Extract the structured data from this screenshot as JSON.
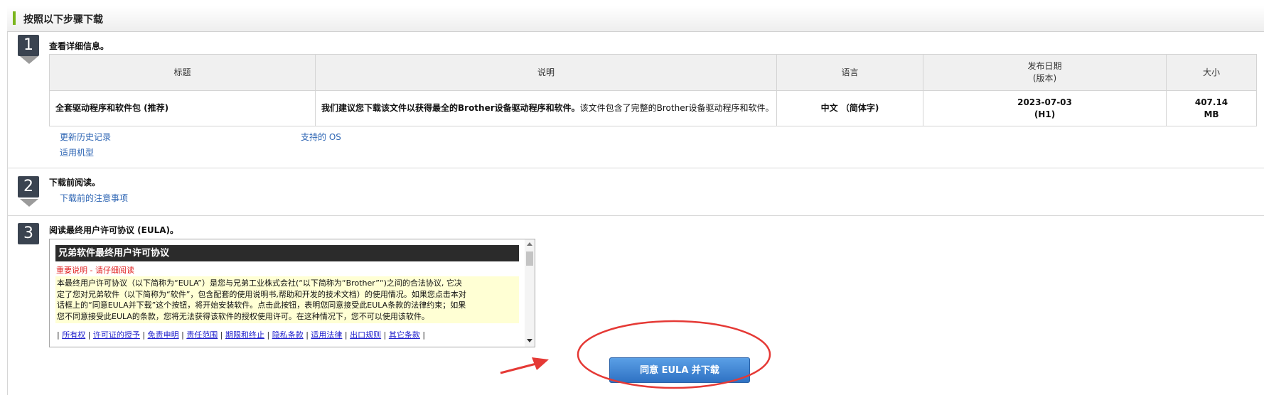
{
  "header": {
    "title": "按照以下步骤下载"
  },
  "steps": [
    {
      "number": "1",
      "title": "查看详细信息。"
    },
    {
      "number": "2",
      "title": "下载前阅读。"
    },
    {
      "number": "3",
      "title": "阅读最终用户许可协议 (EULA)。"
    }
  ],
  "table": {
    "headers": {
      "title": "标题",
      "description": "说明",
      "language": "语言",
      "date_line1": "发布日期",
      "date_line2": "(版本)",
      "size": "大小"
    },
    "row": {
      "title": "全套驱动程序和软件包 (推荐)",
      "description_bold": "我们建议您下载该文件以获得最全的Brother设备驱动程序和软件。",
      "description_rest": "该文件包含了完整的Brother设备驱动程序和软件。",
      "language": "中文 （简体字)",
      "date": "2023-07-03",
      "version": "(H1)",
      "size_value": "407.14",
      "size_unit": "MB"
    }
  },
  "links": {
    "history": "更新历史记录",
    "supported_os": "支持的 OS",
    "models": "适用机型",
    "notes": "下载前的注意事项"
  },
  "eula": {
    "heading": "兄弟软件最终用户许可协议",
    "important": "重要说明 - 请仔细阅读",
    "body": [
      "本最终用户许可协议（以下简称为“EULA”）是您与兄弟工业株式会社(“以下简称为“Brother”“)之间的合法协议, 它决",
      "定了您对兄弟软件（以下简称为“软件”，包含配套的使用说明书,帮助和开发的技术文档）的使用情况。如果您点击本对",
      "话框上的“同意EULA并下载”这个按钮，将开始安装软件。点击此按钮，表明您同意接受此EULA条款的法律约束；如果",
      "您不同意接受此EULA的条款，您将无法获得该软件的授权使用许可。在这种情况下，您不可以使用该软件。"
    ],
    "links": [
      "所有权",
      "许可证的授予",
      "免责申明",
      "责任范围",
      "期限和终止",
      "隐私条款",
      "适用法律",
      "出口规则",
      "其它条款"
    ]
  },
  "download_button": "同意 EULA 并下载",
  "colors": {
    "accent_green": "#7ab51d",
    "step_box": "#3a4350",
    "link_blue": "#2c64b3",
    "button_blue": "#3a80d0",
    "annotation_red": "#e53935"
  }
}
